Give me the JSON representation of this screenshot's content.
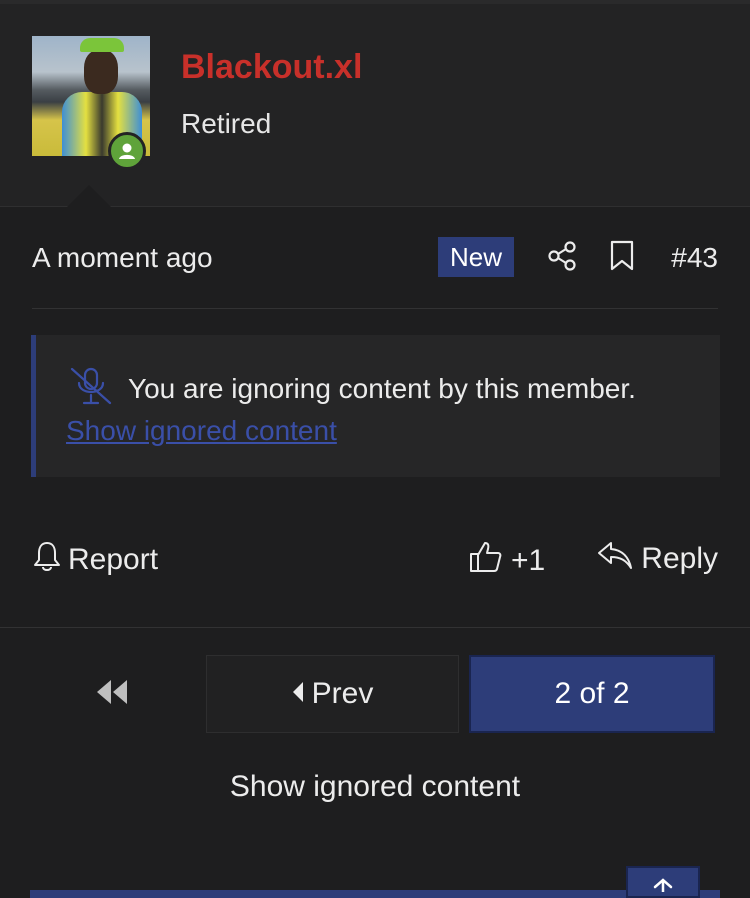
{
  "user": {
    "name": "Blackout.xl",
    "title": "Retired",
    "avatar_icon": "user-avatar-photo",
    "status_icon": "online-user-icon"
  },
  "post": {
    "time": "A moment ago",
    "badge": "New",
    "number": "#43"
  },
  "ignore_notice": {
    "icon": "microphone-slash-icon",
    "message": "You are ignoring content by this member.",
    "link": "Show ignored content"
  },
  "actions": {
    "report": "Report",
    "like_count": "+1",
    "reply": "Reply"
  },
  "pagination": {
    "prev": "Prev",
    "current": "2 of 2"
  },
  "footer": {
    "show_ignored": "Show ignored content"
  },
  "colors": {
    "username": "#c8302a",
    "accent": "#2d3d79",
    "link": "#3a4fa8",
    "online": "#5fa33a",
    "background": "#1e1e1f"
  }
}
